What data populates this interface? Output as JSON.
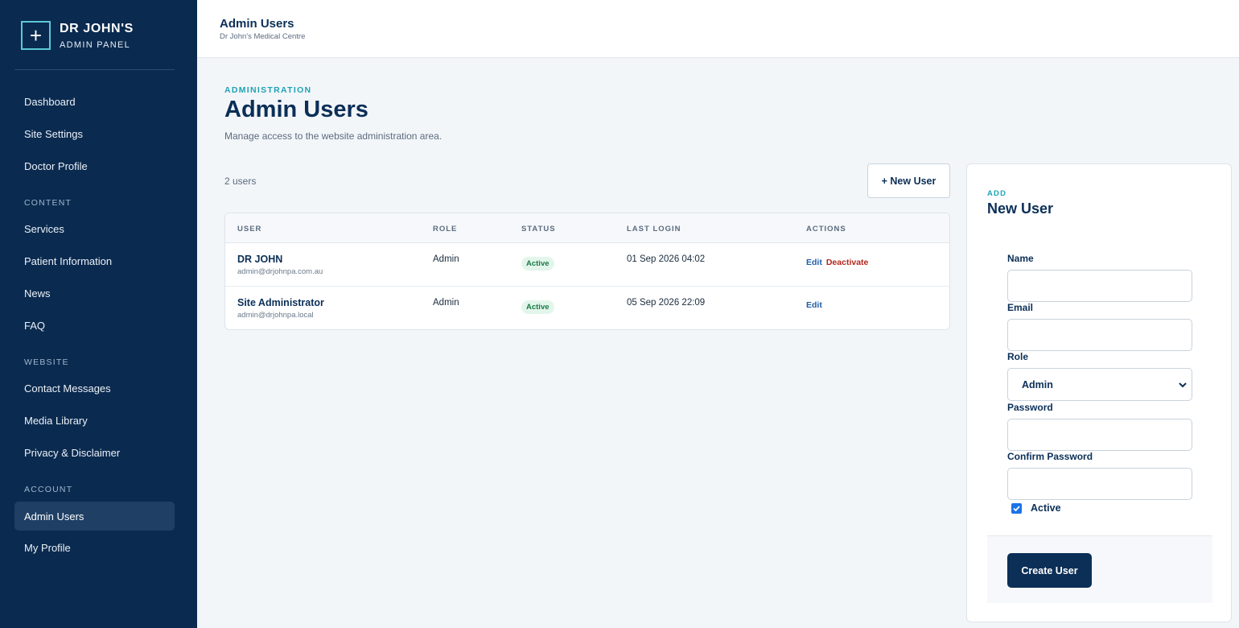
{
  "brand": {
    "title": "DR JOHN'S",
    "subtitle": "ADMIN PANEL",
    "icon": "plus-icon"
  },
  "sidebar": {
    "items": [
      {
        "label": "Dashboard"
      },
      {
        "label": "Site Settings"
      },
      {
        "label": "Doctor Profile"
      },
      {
        "label": "Services"
      },
      {
        "label": "Patient Information"
      },
      {
        "label": "News"
      },
      {
        "label": "FAQ"
      },
      {
        "label": "Contact Messages"
      },
      {
        "label": "Media Library"
      },
      {
        "label": "Privacy & Disclaimer"
      },
      {
        "label": "Admin Users",
        "active": true
      },
      {
        "label": "My Profile"
      }
    ],
    "sections": [
      "CONTENT",
      "WEBSITE",
      "ACCOUNT"
    ]
  },
  "topbar": {
    "title": "Admin Users",
    "subtitle": "Dr John's Medical Centre"
  },
  "header": {
    "eyebrow": "ADMINISTRATION",
    "title": "Admin Users",
    "description": "Manage access to the website administration area."
  },
  "list": {
    "count_text": "2 users",
    "new_user_label": "+ New User",
    "columns": [
      "USER",
      "ROLE",
      "STATUS",
      "LAST LOGIN",
      "ACTIONS"
    ],
    "rows": [
      {
        "name": "DR JOHN",
        "email": "admin@drjohnpa.com.au",
        "role": "Admin",
        "status": "Active",
        "last_login": "01 Sep 2026 04:02",
        "edit": "Edit",
        "deactivate": "Deactivate"
      },
      {
        "name": "Site Administrator",
        "email": "admin@drjohnpa.local",
        "role": "Admin",
        "status": "Active",
        "last_login": "05 Sep 2026 22:09",
        "edit": "Edit"
      }
    ]
  },
  "form": {
    "eyebrow": "ADD",
    "title": "New User",
    "name_label": "Name",
    "email_label": "Email",
    "role_label": "Role",
    "role_value": "Admin",
    "password_label": "Password",
    "confirm_label": "Confirm Password",
    "active_label": "Active",
    "active_checked": true,
    "submit_label": "Create User"
  },
  "colors": {
    "sidebar": "#0b2a4f",
    "accent": "#1ea3b3",
    "primary": "#0b2f57",
    "danger": "#b3261e",
    "success": "#1a7a45"
  }
}
